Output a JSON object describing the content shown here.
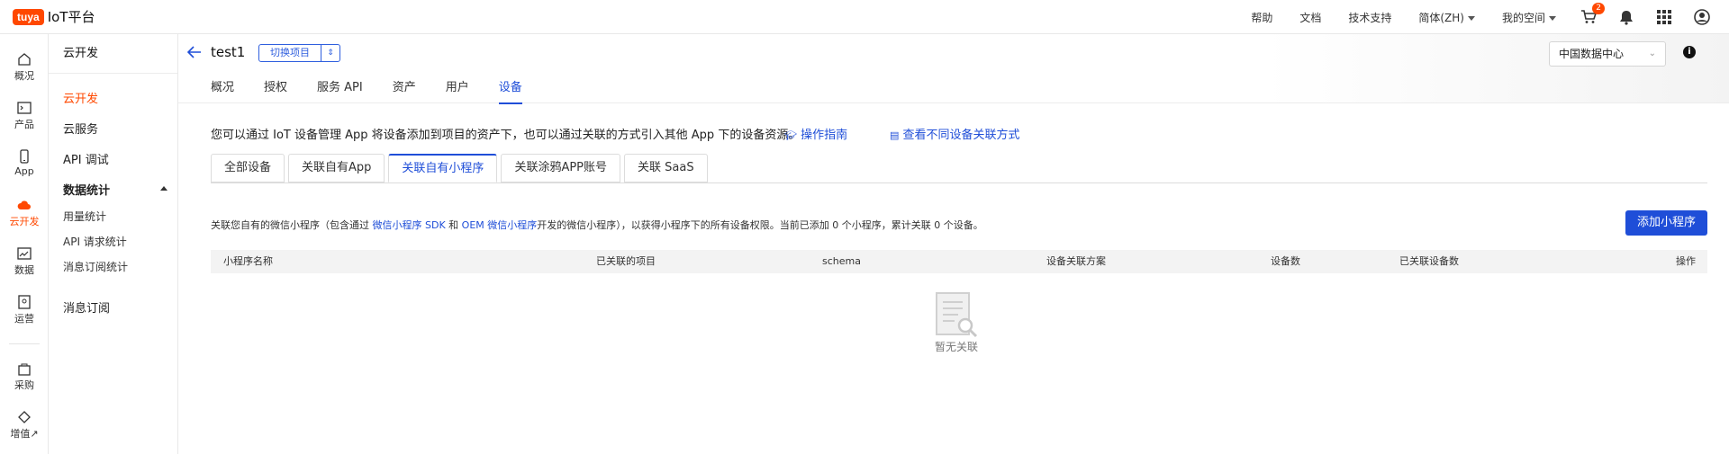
{
  "brand": {
    "badge": "tuya",
    "name": "IoT平台"
  },
  "topnav": {
    "help": "帮助",
    "docs": "文档",
    "support": "技术支持",
    "language": "简体(ZH)",
    "space": "我的空间",
    "cart_count": "2"
  },
  "iconbar": [
    {
      "label": "概况"
    },
    {
      "label": "产品"
    },
    {
      "label": "App"
    },
    {
      "label": "云开发"
    },
    {
      "label": "数据"
    },
    {
      "label": "运营"
    },
    {
      "label": "采购"
    },
    {
      "label": "增值↗"
    }
  ],
  "sidebar": {
    "header": "云开发",
    "items": [
      {
        "label": "云开发"
      },
      {
        "label": "云服务"
      },
      {
        "label": "API 调试"
      },
      {
        "label": "数据统计"
      },
      {
        "label": "用量统计"
      },
      {
        "label": "API 请求统计"
      },
      {
        "label": "消息订阅统计"
      },
      {
        "label": "消息订阅"
      }
    ]
  },
  "project": {
    "name": "test1",
    "switch_label": "切换项目",
    "tabs": [
      "概况",
      "授权",
      "服务 API",
      "资产",
      "用户",
      "设备"
    ],
    "active_tab": "设备",
    "region": "中国数据中心"
  },
  "intro": {
    "text": "您可以通过 IoT 设备管理 App 将设备添加到项目的资产下，也可以通过关联的方式引入其他 App 下的设备资源。",
    "guide_link": "操作指南",
    "compare_link": "查看不同设备关联方式"
  },
  "subtabs": [
    "全部设备",
    "关联自有App",
    "关联自有小程序",
    "关联涂鸦APP账号",
    "关联 SaaS"
  ],
  "desc": {
    "part1": "关联您自有的微信小程序（包含通过 ",
    "link1": "微信小程序 SDK",
    "part2": " 和 ",
    "link2": "OEM 微信小程序",
    "part3": "开发的微信小程序），以获得小程序下的所有设备权限。当前已添加 0 个小程序，累计关联 0 个设备。"
  },
  "add_button": "添加小程序",
  "table": {
    "columns": [
      "小程序名称",
      "已关联的项目",
      "schema",
      "设备关联方案",
      "设备数",
      "已关联设备数",
      "操作"
    ]
  },
  "empty_text": "暂无关联",
  "colors": {
    "brand": "#ff4800",
    "primary": "#1f4ed8"
  }
}
